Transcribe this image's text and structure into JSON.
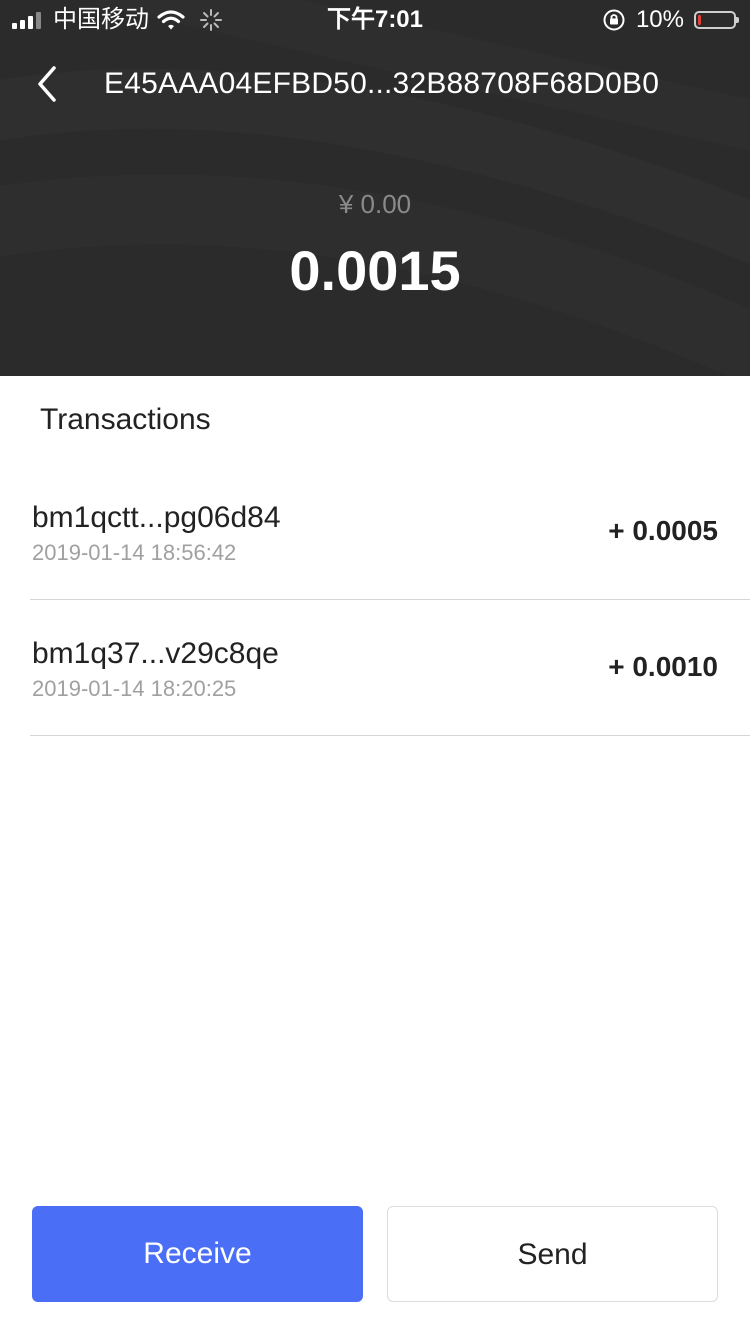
{
  "status_bar": {
    "carrier": "中国移动",
    "time": "下午7:01",
    "battery": "10%",
    "battery_level": 0.1,
    "icons": [
      "signal-icon",
      "wifi-icon",
      "loading-icon",
      "orientation-lock-icon",
      "battery-icon"
    ]
  },
  "nav": {
    "back_icon": "chevron-left-icon",
    "title": "E45AAA04EFBD50...32B88708F68D0B0"
  },
  "wallet": {
    "fiat_value": "¥ 0.00",
    "balance": "0.0015"
  },
  "transactions": {
    "heading": "Transactions",
    "items": [
      {
        "address": "bm1qctt...pg06d84",
        "date": "2019-01-14 18:56:42",
        "amount": "+ 0.0005"
      },
      {
        "address": "bm1q37...v29c8qe",
        "date": "2019-01-14 18:20:25",
        "amount": "+ 0.0010"
      }
    ]
  },
  "actions": {
    "receive_label": "Receive",
    "send_label": "Send"
  },
  "colors": {
    "header_bg": "#2b2b2b",
    "accent": "#4a6ef5",
    "battery_low": "#e0423a"
  }
}
